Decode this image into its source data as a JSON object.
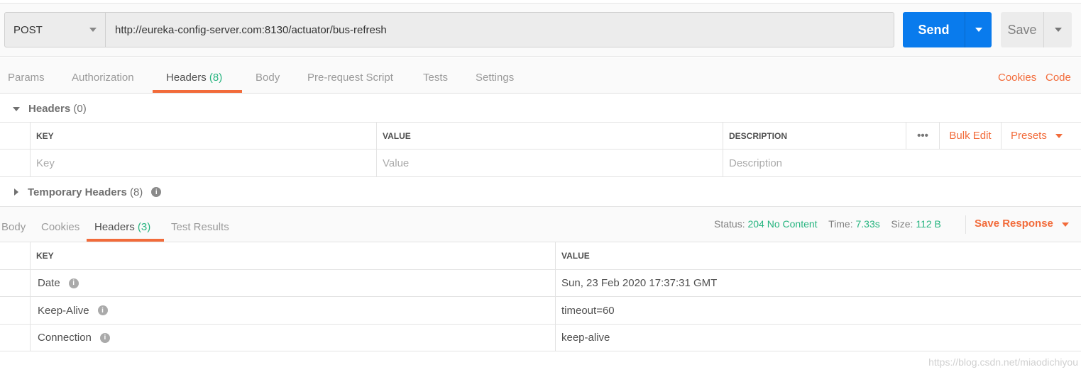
{
  "request": {
    "method": "POST",
    "url": "http://eureka-config-server.com:8130/actuator/bus-refresh",
    "send_label": "Send",
    "save_label": "Save"
  },
  "request_tabs": [
    {
      "label": "Params"
    },
    {
      "label": "Authorization"
    },
    {
      "label": "Headers",
      "count": "(8)"
    },
    {
      "label": "Body"
    },
    {
      "label": "Pre-request Script"
    },
    {
      "label": "Tests"
    },
    {
      "label": "Settings"
    }
  ],
  "links": {
    "cookies": "Cookies",
    "code": "Code"
  },
  "headers_section": {
    "title": "Headers",
    "count": "(0)",
    "columns": {
      "key": "KEY",
      "value": "VALUE",
      "description": "DESCRIPTION"
    },
    "more_label": "•••",
    "bulk_edit": "Bulk Edit",
    "presets": "Presets",
    "placeholders": {
      "key": "Key",
      "value": "Value",
      "description": "Description"
    }
  },
  "temporary_headers": {
    "title": "Temporary Headers",
    "count": "(8)"
  },
  "response_tabs": [
    {
      "label": "Body"
    },
    {
      "label": "Cookies"
    },
    {
      "label": "Headers",
      "count": "(3)"
    },
    {
      "label": "Test Results"
    }
  ],
  "response_status": {
    "status_label": "Status:",
    "status": "204 No Content",
    "time_label": "Time:",
    "time": "7.33s",
    "size_label": "Size:",
    "size": "112 B",
    "save_response": "Save Response"
  },
  "response_headers": {
    "columns": {
      "key": "KEY",
      "value": "VALUE"
    },
    "rows": [
      {
        "key": "Date",
        "value": "Sun, 23 Feb 2020 17:37:31 GMT"
      },
      {
        "key": "Keep-Alive",
        "value": "timeout=60"
      },
      {
        "key": "Connection",
        "value": "keep-alive"
      }
    ]
  },
  "watermark": "https://blog.csdn.net/miaodichiyou",
  "colors": {
    "accent": "#f26b3a",
    "send": "#097bed",
    "success": "#26b47f"
  }
}
